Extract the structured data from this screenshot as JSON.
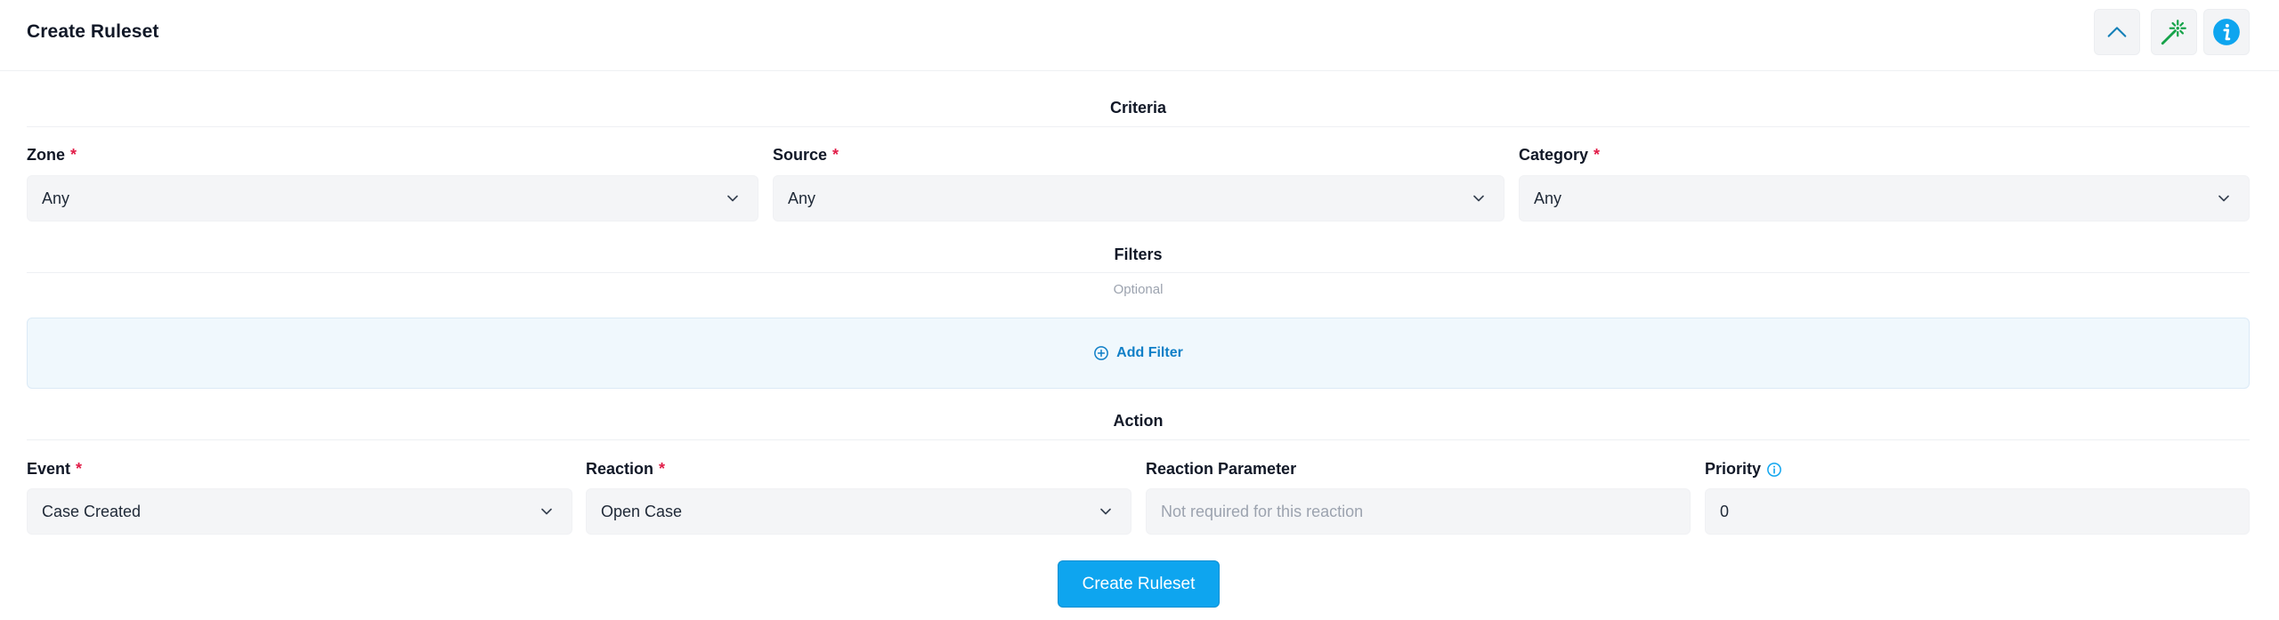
{
  "header": {
    "title": "Create Ruleset",
    "buttons": {
      "collapse_icon": "chevron-up-icon",
      "magic_icon": "magic-wand-icon",
      "info_icon": "info-icon"
    }
  },
  "criteria": {
    "title": "Criteria",
    "fields": {
      "zone": {
        "label": "Zone",
        "value": "Any",
        "required_mark": "*"
      },
      "source": {
        "label": "Source",
        "value": "Any",
        "required_mark": "*"
      },
      "category": {
        "label": "Category",
        "value": "Any",
        "required_mark": "*"
      }
    }
  },
  "filters": {
    "title": "Filters",
    "subtitle": "Optional",
    "add_label": "Add Filter"
  },
  "action": {
    "title": "Action",
    "fields": {
      "event": {
        "label": "Event",
        "value": "Case Created",
        "required_mark": "*"
      },
      "reaction": {
        "label": "Reaction",
        "value": "Open Case",
        "required_mark": "*"
      },
      "reaction_parameter": {
        "label": "Reaction Parameter",
        "placeholder": "Not required for this reaction"
      },
      "priority": {
        "label": "Priority",
        "value": "0"
      }
    }
  },
  "submit": {
    "label": "Create Ruleset"
  },
  "colors": {
    "accent": "#0ea5ef",
    "link": "#0f7fc7",
    "required": "#e11d48",
    "magic_wand": "#16a34a",
    "info": "#0ea5ef"
  }
}
